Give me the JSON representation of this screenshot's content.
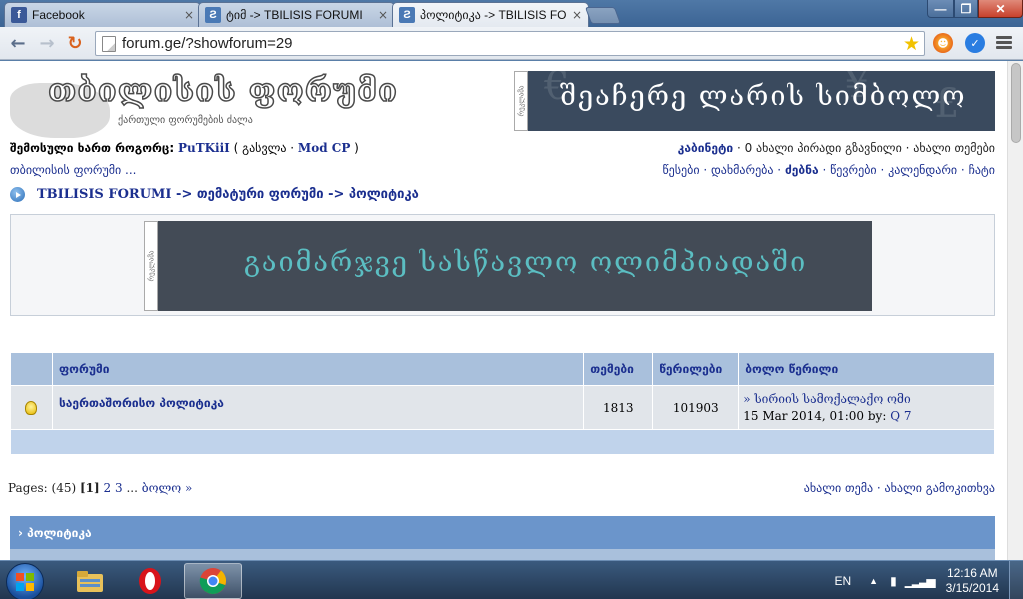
{
  "browser": {
    "tabs": [
      {
        "title": "Facebook",
        "favicon": "facebook-icon",
        "favicon_letter": "f",
        "active": false
      },
      {
        "title": "ტიმ -> TBILISIS FORUMI",
        "favicon": "forum-icon",
        "favicon_letter": "Ƨ",
        "active": false
      },
      {
        "title": "პოლიტიკა -> TBILISIS FO",
        "favicon": "forum-icon",
        "favicon_letter": "Ƨ",
        "active": true
      }
    ],
    "tab_close": "×",
    "url": "forum.ge/?showforum=29",
    "window_controls": {
      "minimize": "—",
      "maximize": "❐",
      "close": "✕"
    }
  },
  "header": {
    "logo_title": "თბილისის ფორუმი",
    "logo_subtitle": "ქართული ფორუმების ძალა",
    "banner_text": "შეაჩერე ლარის სიმბოლო",
    "ad_label": "რეკლამა"
  },
  "userbar": {
    "logged_in_prefix": "შემოსული ხართ როგორც:",
    "username": "PuTKiiI",
    "logout": "გასვლა",
    "modcp": "Mod CP",
    "cabinet": "კაბინეტი",
    "pm": "0 ახალი პირადი გზავნილი",
    "new_topics": "ახალი თემები",
    "forum_link": "თბილისის ფორუმი ...",
    "rules": "წესები",
    "help": "დახმარება",
    "search": "ძებნა",
    "members": "წევრები",
    "calendar": "კალენდარი",
    "chat": "ჩატი"
  },
  "breadcrumb": {
    "root": "TBILISIS FORUMI",
    "sep": "->",
    "level1": "თემატური ფორუმი",
    "level2": "პოლიტიკა"
  },
  "ad2": {
    "text": "გაიმარჯვე სასწავლო ოლიმპიადაში",
    "label": "რეკლამა"
  },
  "forum_table": {
    "headers": [
      "ფორუმი",
      "თემები",
      "წერილები",
      "ბოლო წერილი"
    ],
    "row": {
      "name": "საერთაშორისო პოლიტიკა",
      "topics": "1813",
      "posts": "101903",
      "last_title": "» სირიის სამოქალაქო ომი",
      "last_date": "15 Mar 2014, 01:00 by:",
      "last_user": "Q 7"
    }
  },
  "pagination": {
    "label": "Pages:",
    "count": "(45)",
    "current": "[1]",
    "p2": "2",
    "p3": "3",
    "ellipsis": "...",
    "last": "ბოლო »"
  },
  "actions": {
    "new_topic": "ახალი თემა",
    "new_poll": "ახალი გამოკითხვა"
  },
  "section": {
    "title": "› პოლიტიკა"
  },
  "taskbar": {
    "lang": "EN",
    "time": "12:16 AM",
    "date": "3/15/2014"
  },
  "colors": {
    "link": "#1b2f8f",
    "header_bg": "#a9c0dc",
    "section_bg": "#6b95cb"
  }
}
